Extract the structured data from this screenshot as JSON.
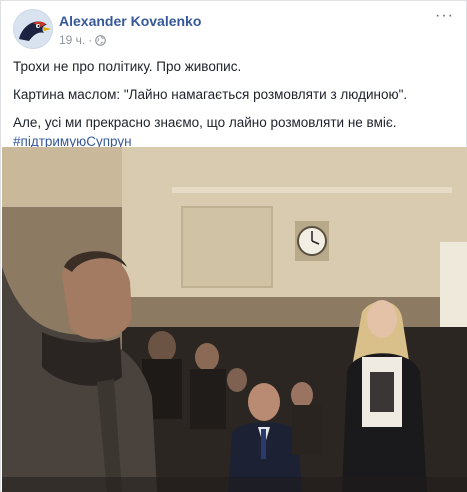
{
  "post": {
    "author_name": "Alexander Kovalenko",
    "timestamp": "19 ч.",
    "separator": "·",
    "privacy_icon": "globe-icon",
    "more_icon": "more-options-icon",
    "more_label": "···",
    "lines": [
      "Трохи не про політику. Про живопис.",
      "Картина маслом: \"Лайно намагається розмовляти з людиною\".",
      "Але, усі ми прекрасно знаємо, що лайно розмовляти не вміє."
    ],
    "hashtag": "#підтримуюСупрун"
  },
  "photo": {
    "description_icon": "photo-image"
  },
  "colors": {
    "link": "#365899",
    "text": "#1d2129",
    "meta": "#90949c"
  }
}
